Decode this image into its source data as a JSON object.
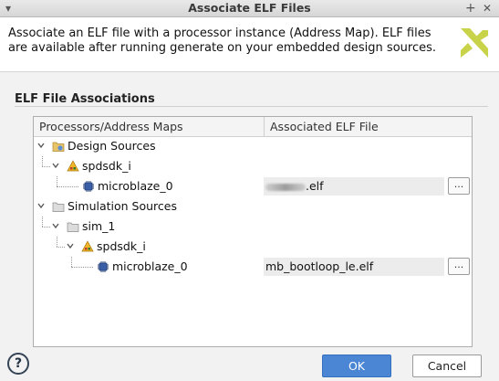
{
  "window": {
    "title": "Associate ELF Files"
  },
  "header": {
    "description": "Associate an ELF file with a processor instance (Address Map). ELF files are available after running generate on your embedded design sources."
  },
  "section": {
    "title": "ELF File Associations"
  },
  "table": {
    "columns": [
      "Processors/Address Maps",
      "Associated ELF File"
    ],
    "rows": [
      {
        "label": "Design Sources",
        "icon": "design-sources-icon"
      },
      {
        "label": "spdsdk_i",
        "icon": "block-design-icon"
      },
      {
        "label": "microblaze_0",
        "icon": "processor-icon",
        "elf": ".elf",
        "browse": "..."
      },
      {
        "label": "Simulation Sources",
        "icon": "folder-icon"
      },
      {
        "label": "sim_1",
        "icon": "folder-icon"
      },
      {
        "label": "spdsdk_i",
        "icon": "block-design-icon"
      },
      {
        "label": "microblaze_0",
        "icon": "processor-icon",
        "elf": "mb_bootloop_le.elf",
        "browse": "..."
      }
    ]
  },
  "footer": {
    "help": "?",
    "ok": "OK",
    "cancel": "Cancel"
  },
  "colors": {
    "accent": "#4a86d4",
    "logo": "#c8d34a",
    "field_bg": "#ececec"
  }
}
